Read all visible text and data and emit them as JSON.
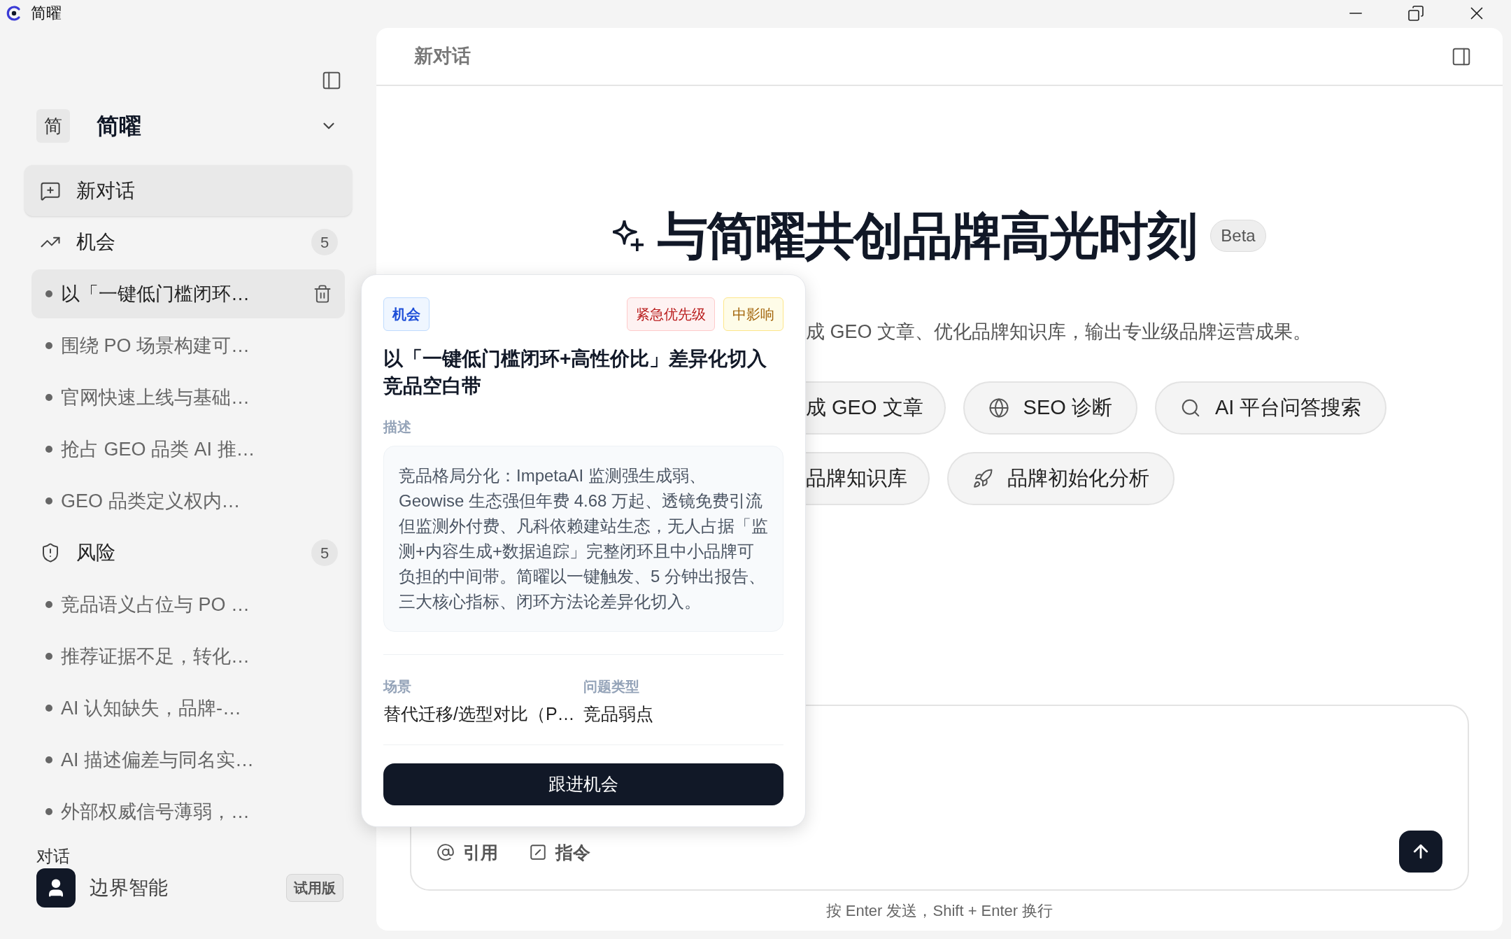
{
  "window": {
    "title": "简曜"
  },
  "sidebar": {
    "workspace": {
      "initial": "简",
      "name": "简曜"
    },
    "new_chat": "新对话",
    "groups": [
      {
        "kind": "opportunity",
        "label": "机会",
        "count": "5",
        "items": [
          {
            "label": "以「一键低门槛闭环…",
            "selected": true
          },
          {
            "label": "围绕 PO 场景构建可…",
            "selected": false
          },
          {
            "label": "官网快速上线与基础…",
            "selected": false
          },
          {
            "label": "抢占 GEO 品类 AI 推…",
            "selected": false
          },
          {
            "label": "GEO 品类定义权内…",
            "selected": false
          }
        ]
      },
      {
        "kind": "risk",
        "label": "风险",
        "count": "5",
        "items": [
          {
            "label": "竞品语义占位与 PO …",
            "selected": false
          },
          {
            "label": "推荐证据不足，转化…",
            "selected": false
          },
          {
            "label": "AI 认知缺失，品牌-…",
            "selected": false
          },
          {
            "label": "AI 描述偏差与同名实…",
            "selected": false
          },
          {
            "label": "外部权威信号薄弱，…",
            "selected": false
          }
        ]
      }
    ],
    "section_label": "对话",
    "user": {
      "name": "边界智能",
      "plan": "试用版"
    }
  },
  "main": {
    "header_title": "新对话",
    "hero": {
      "title": "与简曜共创品牌高光时刻",
      "badge": "Beta",
      "subtitle": "成 GEO 文章、优化品牌知识库，输出专业级品牌运营成果。"
    },
    "action_rows": [
      [
        {
          "kind": "article",
          "label": "成 GEO 文章",
          "clipped": true
        },
        {
          "kind": "globe",
          "label": "SEO 诊断",
          "clipped": false
        },
        {
          "kind": "search",
          "label": "AI 平台问答搜索",
          "clipped": false
        }
      ],
      [
        {
          "kind": "knowledge",
          "label": "品牌知识库",
          "clipped": true
        },
        {
          "kind": "rocket",
          "label": "品牌初始化分析",
          "clipped": false
        }
      ]
    ],
    "composer": {
      "tools": [
        {
          "kind": "mention",
          "label": "引用"
        },
        {
          "kind": "command",
          "label": "指令"
        }
      ]
    },
    "hint": "按 Enter 发送，Shift + Enter 换行"
  },
  "popover": {
    "tags": [
      {
        "kind": "category",
        "label": "机会"
      },
      {
        "kind": "priority",
        "label": "紧急优先级"
      },
      {
        "kind": "impact",
        "label": "中影响"
      }
    ],
    "title": "以「一键低门槛闭环+高性价比」差异化切入竞品空白带",
    "description_label": "描述",
    "description": "竞品格局分化：ImpetaAI 监测强生成弱、Geowise 生态强但年费 4.68 万起、透镜免费引流但监测外付费、凡科依赖建站生态，无人占据「监测+内容生成+数据追踪」完整闭环且中小品牌可负担的中间带。简曜以一键触发、5 分钟出报告、三大核心指标、闭环方法论差异化切入。",
    "fields": [
      {
        "label": "场景",
        "value": "替代迁移/选型对比（P…"
      },
      {
        "label": "问题类型",
        "value": "竞品弱点"
      }
    ],
    "button": "跟进机会"
  }
}
